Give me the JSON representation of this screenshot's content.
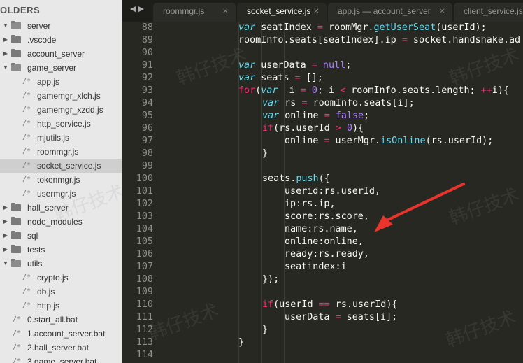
{
  "sidebar": {
    "header": "OLDERS",
    "items": [
      {
        "label": "server",
        "type": "folder-open",
        "level": 0
      },
      {
        "label": ".vscode",
        "type": "folder",
        "level": 1
      },
      {
        "label": "account_server",
        "type": "folder",
        "level": 1
      },
      {
        "label": "game_server",
        "type": "folder-open",
        "level": 1
      },
      {
        "label": "app.js",
        "type": "file",
        "level": 2
      },
      {
        "label": "gamemgr_xlch.js",
        "type": "file",
        "level": 2
      },
      {
        "label": "gamemgr_xzdd.js",
        "type": "file",
        "level": 2
      },
      {
        "label": "http_service.js",
        "type": "file",
        "level": 2
      },
      {
        "label": "mjutils.js",
        "type": "file",
        "level": 2
      },
      {
        "label": "roommgr.js",
        "type": "file",
        "level": 2
      },
      {
        "label": "socket_service.js",
        "type": "file",
        "level": 2,
        "selected": true
      },
      {
        "label": "tokenmgr.js",
        "type": "file",
        "level": 2
      },
      {
        "label": "usermgr.js",
        "type": "file",
        "level": 2
      },
      {
        "label": "hall_server",
        "type": "folder",
        "level": 1
      },
      {
        "label": "node_modules",
        "type": "folder",
        "level": 1
      },
      {
        "label": "sql",
        "type": "folder",
        "level": 1
      },
      {
        "label": "tests",
        "type": "folder",
        "level": 1
      },
      {
        "label": "utils",
        "type": "folder-open",
        "level": 1
      },
      {
        "label": "crypto.js",
        "type": "file",
        "level": 2
      },
      {
        "label": "db.js",
        "type": "file",
        "level": 2
      },
      {
        "label": "http.js",
        "type": "file",
        "level": 2
      },
      {
        "label": "0.start_all.bat",
        "type": "file",
        "level": 1
      },
      {
        "label": "1.account_server.bat",
        "type": "file",
        "level": 1
      },
      {
        "label": "2.hall_server.bat",
        "type": "file",
        "level": 1
      },
      {
        "label": "3.game_server.bat",
        "type": "file",
        "level": 1
      }
    ]
  },
  "tabbar": {
    "nav": "◀ ▶",
    "tabs": [
      {
        "label": "roommgr.js",
        "active": false
      },
      {
        "label": "socket_service.js",
        "active": true
      },
      {
        "label": "app.js — account_server",
        "active": false
      },
      {
        "label": "client_service.js",
        "active": false
      }
    ],
    "close_glyph": "⨯"
  },
  "editor": {
    "lines": [
      {
        "n": "88",
        "indent": 0,
        "tokens": [
          [
            "kw",
            "var"
          ],
          [
            "",
            "seatIndex "
          ],
          [
            "op",
            "="
          ],
          [
            "",
            " roomMgr."
          ],
          [
            "fn",
            "getUserSeat"
          ],
          [
            "",
            "(userId);"
          ]
        ]
      },
      {
        "n": "89",
        "indent": 0,
        "tokens": [
          [
            "",
            "roomInfo.seats[seatIndex].ip "
          ],
          [
            "op",
            "="
          ],
          [
            "",
            " socket.handshake.ad"
          ]
        ]
      },
      {
        "n": "90",
        "indent": 0,
        "tokens": []
      },
      {
        "n": "91",
        "indent": 0,
        "tokens": [
          [
            "kw",
            "var"
          ],
          [
            "",
            "userData "
          ],
          [
            "op",
            "="
          ],
          [
            "",
            ""
          ],
          [
            "num",
            " null"
          ],
          [
            "",
            ";"
          ]
        ]
      },
      {
        "n": "92",
        "indent": 0,
        "tokens": [
          [
            "kw",
            "var"
          ],
          [
            "",
            "seats "
          ],
          [
            "op",
            "="
          ],
          [
            "",
            " [];"
          ]
        ]
      },
      {
        "n": "93",
        "indent": 0,
        "tokens": [
          [
            "op",
            "for"
          ],
          [
            "",
            "("
          ],
          [
            "kw",
            "var"
          ],
          [
            "",
            " i "
          ],
          [
            "op",
            "="
          ],
          [
            "",
            " "
          ],
          [
            "num",
            "0"
          ],
          [
            "",
            "; i "
          ],
          [
            "op",
            "<"
          ],
          [
            "",
            " roomInfo.seats.length; "
          ],
          [
            "op",
            "++"
          ],
          [
            "",
            "i){"
          ]
        ]
      },
      {
        "n": "94",
        "indent": 1,
        "tokens": [
          [
            "kw",
            "var"
          ],
          [
            "",
            "rs "
          ],
          [
            "op",
            "="
          ],
          [
            "",
            " roomInfo.seats[i];"
          ]
        ]
      },
      {
        "n": "95",
        "indent": 1,
        "tokens": [
          [
            "kw",
            "var"
          ],
          [
            "",
            "online "
          ],
          [
            "op",
            "="
          ],
          [
            "",
            " "
          ],
          [
            "num",
            "false"
          ],
          [
            "",
            ";"
          ]
        ]
      },
      {
        "n": "96",
        "indent": 1,
        "tokens": [
          [
            "op",
            "if"
          ],
          [
            "",
            "(rs.userId "
          ],
          [
            "op",
            ">"
          ],
          [
            "",
            " "
          ],
          [
            "num",
            "0"
          ],
          [
            "",
            "){"
          ]
        ]
      },
      {
        "n": "97",
        "indent": 2,
        "tokens": [
          [
            "",
            "online "
          ],
          [
            "op",
            "="
          ],
          [
            "",
            " userMgr."
          ],
          [
            "fn",
            "isOnline"
          ],
          [
            "",
            "(rs.userId);"
          ]
        ]
      },
      {
        "n": "98",
        "indent": 1,
        "tokens": [
          [
            "",
            "}"
          ]
        ]
      },
      {
        "n": "99",
        "indent": 0,
        "tokens": []
      },
      {
        "n": "100",
        "indent": 1,
        "tokens": [
          [
            "",
            "seats."
          ],
          [
            "fn",
            "push"
          ],
          [
            "",
            "({"
          ]
        ]
      },
      {
        "n": "101",
        "indent": 2,
        "tokens": [
          [
            "",
            "userid:rs.userId,"
          ]
        ]
      },
      {
        "n": "102",
        "indent": 2,
        "tokens": [
          [
            "",
            "ip:rs.ip,"
          ]
        ]
      },
      {
        "n": "103",
        "indent": 2,
        "tokens": [
          [
            "",
            "score:rs.score,"
          ]
        ]
      },
      {
        "n": "104",
        "indent": 2,
        "tokens": [
          [
            "",
            "name:rs.name,"
          ]
        ]
      },
      {
        "n": "105",
        "indent": 2,
        "tokens": [
          [
            "",
            "online:online,"
          ]
        ]
      },
      {
        "n": "106",
        "indent": 2,
        "tokens": [
          [
            "",
            "ready:rs.ready,"
          ]
        ]
      },
      {
        "n": "107",
        "indent": 2,
        "tokens": [
          [
            "",
            "seatindex:i"
          ]
        ]
      },
      {
        "n": "108",
        "indent": 1,
        "tokens": [
          [
            "",
            "});"
          ]
        ]
      },
      {
        "n": "109",
        "indent": 0,
        "tokens": []
      },
      {
        "n": "110",
        "indent": 1,
        "tokens": [
          [
            "op",
            "if"
          ],
          [
            "",
            "(userId "
          ],
          [
            "op",
            "=="
          ],
          [
            "",
            " rs.userId){"
          ]
        ]
      },
      {
        "n": "111",
        "indent": 2,
        "tokens": [
          [
            "",
            "userData "
          ],
          [
            "op",
            "="
          ],
          [
            "",
            " seats[i];"
          ]
        ]
      },
      {
        "n": "112",
        "indent": 1,
        "tokens": [
          [
            "",
            "}"
          ]
        ]
      },
      {
        "n": "113",
        "indent": 0,
        "tokens": [
          [
            "",
            "}"
          ]
        ]
      },
      {
        "n": "114",
        "indent": 0,
        "tokens": []
      }
    ]
  },
  "watermark": "韩仔技术",
  "colors": {
    "editor_bg": "#272822",
    "keyword": "#66d9ef",
    "operator": "#f92672",
    "number": "#ae81ff",
    "arrow": "#e8342c",
    "sidebar_bg": "#e8e8e8",
    "selected_bg": "#cfcfcf"
  }
}
